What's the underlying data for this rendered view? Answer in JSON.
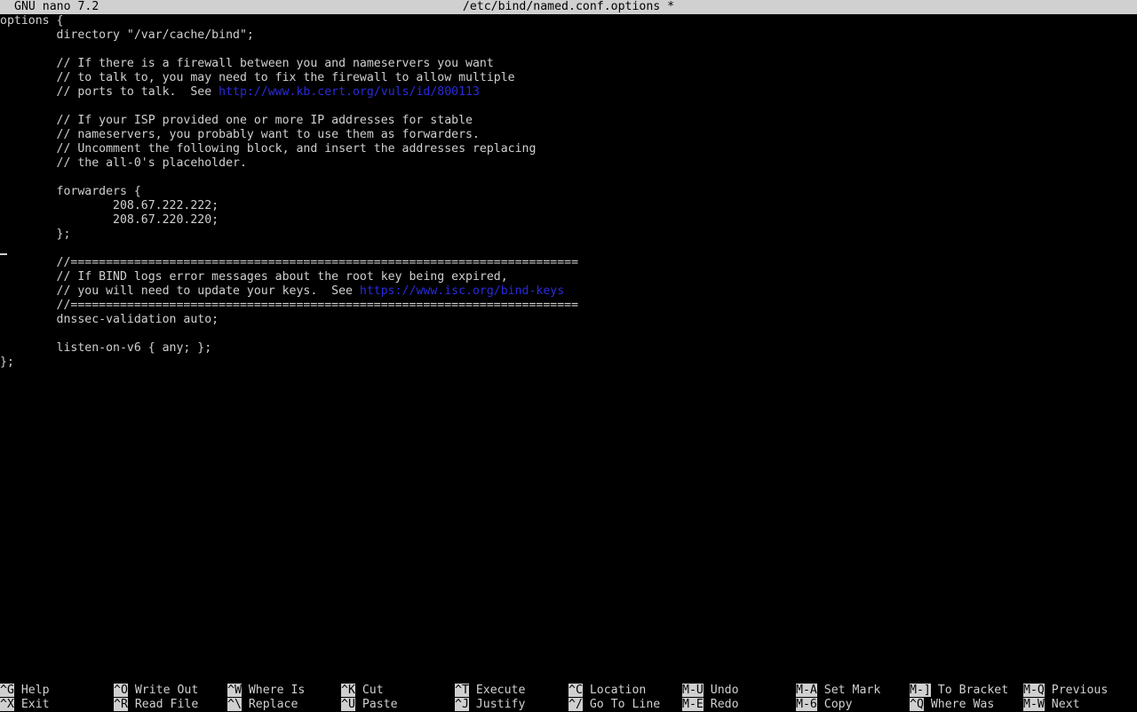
{
  "titlebar": {
    "app_version": "GNU nano 7.2",
    "file_name": "/etc/bind/named.conf.options *"
  },
  "editor": {
    "lines": [
      "options {",
      "        directory \"/var/cache/bind\";",
      "",
      "        // If there is a firewall between you and nameservers you want",
      "        // to talk to, you may need to fix the firewall to allow multiple",
      "        // ports to talk.  See ",
      "",
      "        // If your ISP provided one or more IP addresses for stable",
      "        // nameservers, you probably want to use them as forwarders.",
      "        // Uncomment the following block, and insert the addresses replacing",
      "        // the all-0's placeholder.",
      "",
      "        forwarders {",
      "                208.67.222.222;",
      "                208.67.220.220;",
      "        };",
      "",
      "        //========================================================================",
      "        // If BIND logs error messages about the root key being expired,",
      "        // you will need to update your keys.  See ",
      "        //========================================================================",
      "        dnssec-validation auto;",
      "",
      "        listen-on-v6 { any; };",
      "};"
    ],
    "links": {
      "kb_cert": "http://www.kb.cert.org/vuls/id/800113",
      "isc_bind_keys": "https://www.isc.org/bind-keys"
    }
  },
  "shortcuts": {
    "row1": [
      {
        "key": "^G",
        "label": "Help"
      },
      {
        "key": "^O",
        "label": "Write Out"
      },
      {
        "key": "^W",
        "label": "Where Is"
      },
      {
        "key": "^K",
        "label": "Cut"
      },
      {
        "key": "^T",
        "label": "Execute"
      },
      {
        "key": "^C",
        "label": "Location"
      },
      {
        "key": "M-U",
        "label": "Undo"
      },
      {
        "key": "M-A",
        "label": "Set Mark"
      },
      {
        "key": "M-]",
        "label": "To Bracket"
      },
      {
        "key": "M-Q",
        "label": "Previous"
      }
    ],
    "row2": [
      {
        "key": "^X",
        "label": "Exit"
      },
      {
        "key": "^R",
        "label": "Read File"
      },
      {
        "key": "^\\",
        "label": "Replace"
      },
      {
        "key": "^U",
        "label": "Paste"
      },
      {
        "key": "^J",
        "label": "Justify"
      },
      {
        "key": "^/",
        "label": "Go To Line"
      },
      {
        "key": "M-E",
        "label": "Redo"
      },
      {
        "key": "M-6",
        "label": "Copy"
      },
      {
        "key": "^Q",
        "label": "Where Was"
      },
      {
        "key": "M-W",
        "label": "Next"
      }
    ]
  }
}
